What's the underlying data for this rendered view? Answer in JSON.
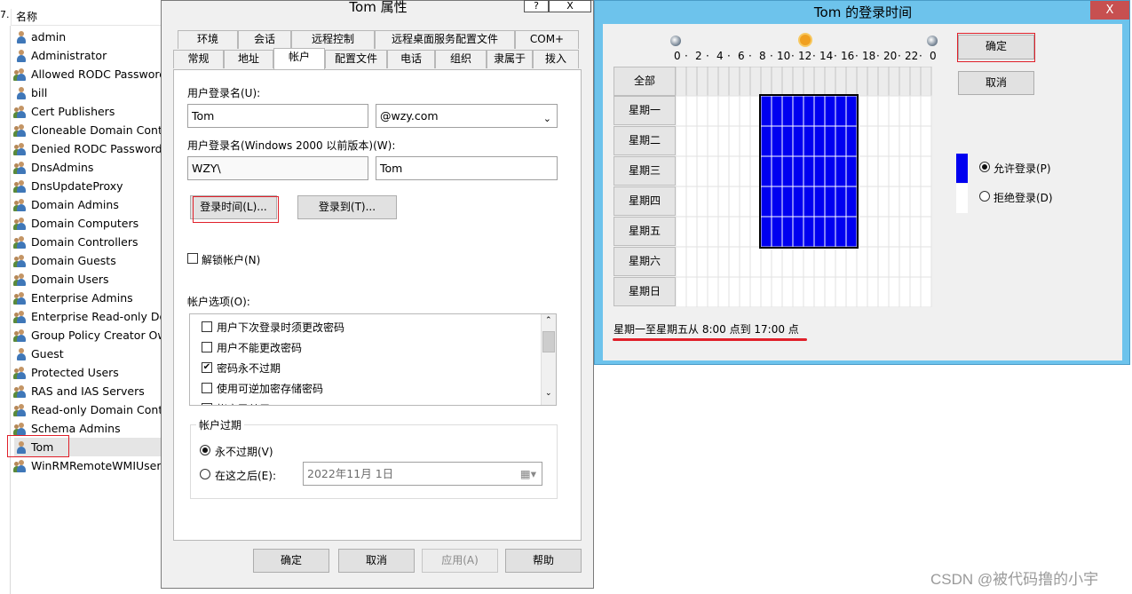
{
  "user_list": {
    "edge_text": "7.",
    "header": "名称",
    "users": [
      {
        "name": "admin",
        "kind": "user"
      },
      {
        "name": "Administrator",
        "kind": "user"
      },
      {
        "name": "Allowed RODC Password",
        "kind": "group"
      },
      {
        "name": "bill",
        "kind": "user"
      },
      {
        "name": "Cert Publishers",
        "kind": "group"
      },
      {
        "name": "Cloneable Domain Contr",
        "kind": "group"
      },
      {
        "name": "Denied RODC Password",
        "kind": "group"
      },
      {
        "name": "DnsAdmins",
        "kind": "group"
      },
      {
        "name": "DnsUpdateProxy",
        "kind": "group"
      },
      {
        "name": "Domain Admins",
        "kind": "group"
      },
      {
        "name": "Domain Computers",
        "kind": "group"
      },
      {
        "name": "Domain Controllers",
        "kind": "group"
      },
      {
        "name": "Domain Guests",
        "kind": "group"
      },
      {
        "name": "Domain Users",
        "kind": "group"
      },
      {
        "name": "Enterprise Admins",
        "kind": "group"
      },
      {
        "name": "Enterprise Read-only Do",
        "kind": "group"
      },
      {
        "name": "Group Policy Creator Ow",
        "kind": "group"
      },
      {
        "name": "Guest",
        "kind": "user"
      },
      {
        "name": "Protected Users",
        "kind": "group"
      },
      {
        "name": "RAS and IAS Servers",
        "kind": "group"
      },
      {
        "name": "Read-only Domain Contr",
        "kind": "group"
      },
      {
        "name": "Schema Admins",
        "kind": "group"
      },
      {
        "name": "Tom",
        "kind": "user",
        "selected": true
      },
      {
        "name": "WinRMRemoteWMIUsers",
        "kind": "group"
      }
    ]
  },
  "props_dialog": {
    "title": "Tom 属性",
    "help_btn": "?",
    "close_btn": "X",
    "tabs_row1": [
      "环境",
      "会话",
      "远程控制",
      "远程桌面服务配置文件",
      "COM+"
    ],
    "tabs_row2": [
      "常规",
      "地址",
      "帐户",
      "配置文件",
      "电话",
      "组织",
      "隶属于",
      "拨入"
    ],
    "active_tab": "帐户",
    "logon_name_label": "用户登录名(U):",
    "logon_name_value": "Tom",
    "domain_value": "@wzy.com",
    "pre2000_label": "用户登录名(Windows 2000 以前版本)(W):",
    "pre2000_domain": "WZY\\",
    "pre2000_name": "Tom",
    "logon_hours_btn": "登录时间(L)...",
    "logon_to_btn": "登录到(T)...",
    "unlock_label": "解锁帐户(N)",
    "options_label": "帐户选项(O):",
    "options": [
      {
        "text": "用户下次登录时须更改密码",
        "checked": false
      },
      {
        "text": "用户不能更改密码",
        "checked": false
      },
      {
        "text": "密码永不过期",
        "checked": true
      },
      {
        "text": "使用可逆加密存储密码",
        "checked": false
      },
      {
        "text": "帐户已禁用",
        "checked": false
      }
    ],
    "expiry_group": "帐户过期",
    "never_expires": "永不过期(V)",
    "end_of": "在这之后(E):",
    "date_value": "2022年11月  1日",
    "ok": "确定",
    "cancel": "取消",
    "apply": "应用(A)",
    "help": "帮助"
  },
  "hours_dialog": {
    "title": "Tom 的登录时间",
    "close": "X",
    "hour_labels": [
      "0",
      "2",
      "4",
      "6",
      "8",
      "10",
      "12",
      "14",
      "16",
      "18",
      "20",
      "22",
      "0"
    ],
    "all_btn": "全部",
    "days": [
      "星期一",
      "星期二",
      "星期三",
      "星期四",
      "星期五",
      "星期六",
      "星期日"
    ],
    "permitted": {
      "days": [
        "星期一",
        "星期二",
        "星期三",
        "星期四",
        "星期五"
      ],
      "from_hour": 8,
      "to_hour": 17
    },
    "permitted_color": "#0000f0",
    "ok": "确定",
    "cancel": "取消",
    "allow_label": "允许登录(P)",
    "deny_label": "拒绝登录(D)",
    "summary": "星期一至星期五从 8:00 点到 17:00 点"
  },
  "watermark": "CSDN @被代码撸的小宇"
}
